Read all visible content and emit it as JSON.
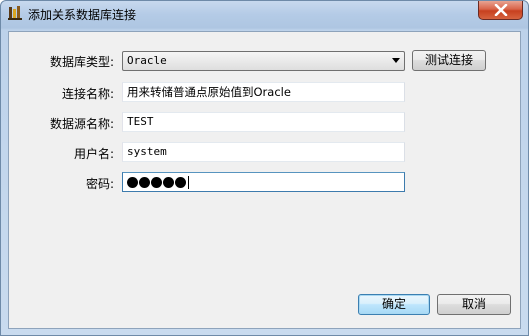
{
  "window": {
    "title": "添加关系数据库连接"
  },
  "form": {
    "db_type": {
      "label": "数据库类型:",
      "value": "Oracle"
    },
    "connection_name": {
      "label": "连接名称:",
      "value": "用来转储普通点原始值到Oracle"
    },
    "datasource_name": {
      "label": "数据源名称:",
      "value": "TEST"
    },
    "username": {
      "label": "用户名:",
      "value": "system"
    },
    "password": {
      "label": "密码:",
      "masked_length": 5
    }
  },
  "buttons": {
    "test_connection": "测试连接",
    "ok": "确定",
    "cancel": "取消"
  },
  "icons": {
    "app": "database-app-icon",
    "close": "close-icon",
    "dropdown": "chevron-down-icon"
  }
}
